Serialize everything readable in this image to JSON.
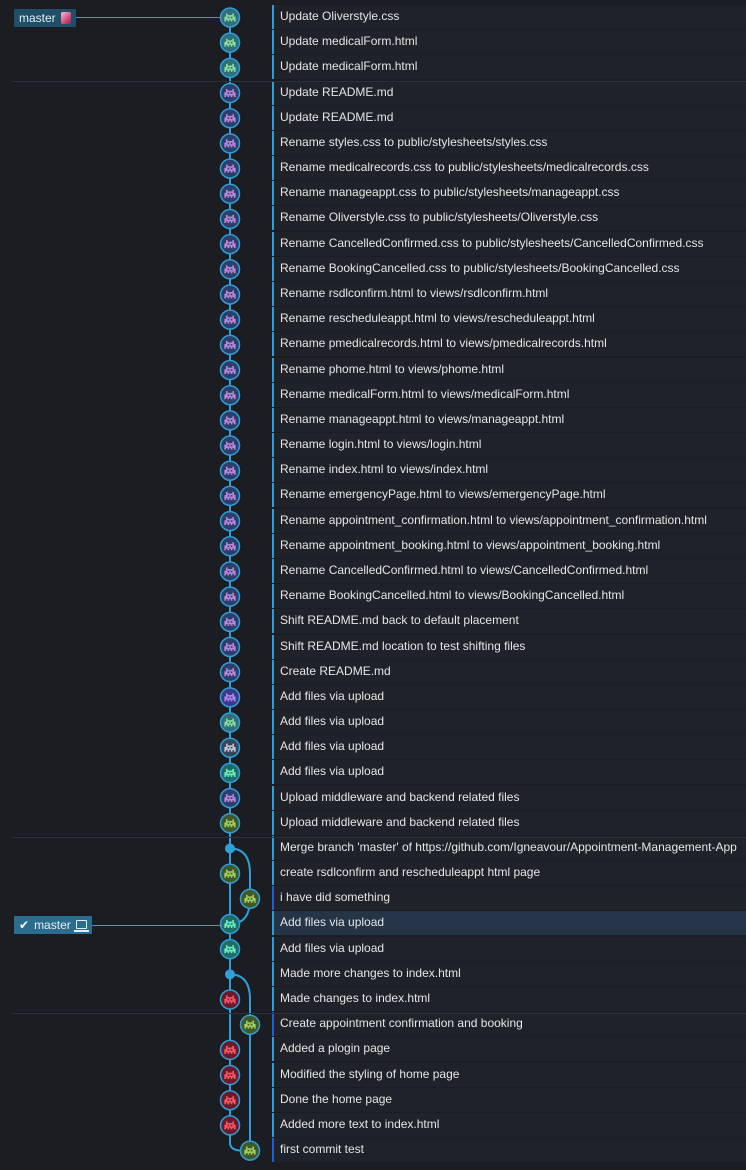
{
  "colors": {
    "row_accent": "#2f9fd8",
    "row_accent_dark": "#1f5fd6",
    "graph_line": "#2f9fd8",
    "selected_row": "#253447",
    "label_bg": "#214f69",
    "avatar_green": "#6fd17a",
    "avatar_purple": "#b57bd6",
    "avatar_red": "#d8344a",
    "avatar_olive": "#6a9a3a",
    "avatar_teal": "#3fbf9a"
  },
  "branches": [
    {
      "name": "master",
      "icon": "avatar-icon",
      "checked_out": false
    },
    {
      "name": "master",
      "icon": "laptop-icon",
      "checked_out": true
    }
  ],
  "commits": [
    {
      "message": "Update Oliverstyle.css",
      "avatar": "green-invader"
    },
    {
      "message": "Update medicalForm.html",
      "avatar": "green-invader"
    },
    {
      "message": "Update medicalForm.html",
      "avatar": "green-invader"
    },
    {
      "message": "Update README.md",
      "avatar": "purple-invader"
    },
    {
      "message": "Update README.md",
      "avatar": "purple-invader"
    },
    {
      "message": "Rename styles.css to public/stylesheets/styles.css",
      "avatar": "purple-invader"
    },
    {
      "message": "Rename medicalrecords.css to public/stylesheets/medicalrecords.css",
      "avatar": "purple-invader"
    },
    {
      "message": "Rename manageappt.css to public/stylesheets/manageappt.css",
      "avatar": "purple-invader"
    },
    {
      "message": "Rename Oliverstyle.css to public/stylesheets/Oliverstyle.css",
      "avatar": "purple-invader"
    },
    {
      "message": "Rename CancelledConfirmed.css to public/stylesheets/CancelledConfirmed.css",
      "avatar": "purple-invader"
    },
    {
      "message": "Rename BookingCancelled.css to public/stylesheets/BookingCancelled.css",
      "avatar": "purple-invader"
    },
    {
      "message": "Rename rsdlconfirm.html to views/rsdlconfirm.html",
      "avatar": "purple-invader"
    },
    {
      "message": "Rename rescheduleappt.html to views/rescheduleappt.html",
      "avatar": "purple-invader"
    },
    {
      "message": "Rename pmedicalrecords.html to views/pmedicalrecords.html",
      "avatar": "purple-invader"
    },
    {
      "message": "Rename phome.html to views/phome.html",
      "avatar": "purple-invader"
    },
    {
      "message": "Rename medicalForm.html to views/medicalForm.html",
      "avatar": "purple-invader"
    },
    {
      "message": "Rename manageappt.html to views/manageappt.html",
      "avatar": "purple-invader"
    },
    {
      "message": "Rename login.html to views/login.html",
      "avatar": "purple-invader"
    },
    {
      "message": "Rename index.html to views/index.html",
      "avatar": "purple-invader"
    },
    {
      "message": "Rename emergencyPage.html to views/emergencyPage.html",
      "avatar": "purple-invader"
    },
    {
      "message": "Rename appointment_confirmation.html to views/appointment_confirmation.html",
      "avatar": "purple-invader"
    },
    {
      "message": "Rename appointment_booking.html to views/appointment_booking.html",
      "avatar": "purple-invader"
    },
    {
      "message": "Rename CancelledConfirmed.html to views/CancelledConfirmed.html",
      "avatar": "purple-invader"
    },
    {
      "message": "Rename BookingCancelled.html to views/BookingCancelled.html",
      "avatar": "purple-invader"
    },
    {
      "message": "Shift README.md back to default placement",
      "avatar": "purple-invader"
    },
    {
      "message": "Shift README.md location to test shifting files",
      "avatar": "purple-invader"
    },
    {
      "message": "Create README.md",
      "avatar": "purple-invader"
    },
    {
      "message": "Add files via upload",
      "avatar": "violet-invader"
    },
    {
      "message": "Add files via upload",
      "avatar": "green-invader"
    },
    {
      "message": "Add files via upload",
      "avatar": "grey-invader"
    },
    {
      "message": "Add files via upload",
      "avatar": "teal-invader"
    },
    {
      "message": "Upload middleware and backend related files",
      "avatar": "purple-invader"
    },
    {
      "message": "Upload middleware and backend related files",
      "avatar": "olive-invader"
    },
    {
      "message": "Merge branch 'master' of https://github.com/Igneavour/Appointment-Management-App",
      "avatar": "merge-dot"
    },
    {
      "message": "create rsdlconfirm and rescheduleappt html page",
      "avatar": "olive-invader"
    },
    {
      "message": "i have did something",
      "avatar": "olive-invader"
    },
    {
      "message": "Add files via upload",
      "avatar": "teal-invader"
    },
    {
      "message": "Add files via upload",
      "avatar": "teal-invader"
    },
    {
      "message": "Made more changes to index.html",
      "avatar": "merge-dot"
    },
    {
      "message": "Made changes to index.html",
      "avatar": "red-invader"
    },
    {
      "message": "Create appointment confirmation and booking",
      "avatar": "olive-invader"
    },
    {
      "message": "Added a plogin page",
      "avatar": "red-invader"
    },
    {
      "message": "Modified the styling of home page",
      "avatar": "red-invader"
    },
    {
      "message": "Done the home page",
      "avatar": "red-invader"
    },
    {
      "message": "Added more text to index.html",
      "avatar": "red-invader"
    },
    {
      "message": "first commit test",
      "avatar": "olive-invader"
    }
  ]
}
